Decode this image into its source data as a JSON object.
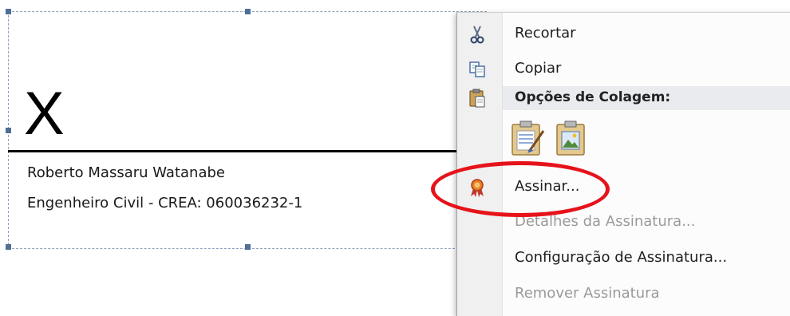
{
  "signature": {
    "x_mark": "X",
    "signer_name": "Roberto Massaru Watanabe",
    "signer_title": "Engenheiro Civil - CREA: 060036232-1"
  },
  "context_menu": {
    "cut": {
      "label": "Recortar",
      "icon": "scissors-icon"
    },
    "copy": {
      "label": "Copiar",
      "icon": "copy-icon"
    },
    "paste_options": {
      "label": "Opções de Colagem:",
      "icon": "clipboard-icon"
    },
    "paste_buttons": [
      {
        "icon": "paste-keep-formatting-icon"
      },
      {
        "icon": "paste-picture-icon"
      }
    ],
    "sign": {
      "label": "Assinar...",
      "icon": "signature-ribbon-icon"
    },
    "signature_details": {
      "label": "Detalhes da Assinatura...",
      "disabled": true
    },
    "signature_setup": {
      "label": "Configuração de Assinatura..."
    },
    "remove_signature": {
      "label": "Remover Assinatura",
      "disabled": true
    }
  },
  "annotation": {
    "color": "#e6131a"
  }
}
